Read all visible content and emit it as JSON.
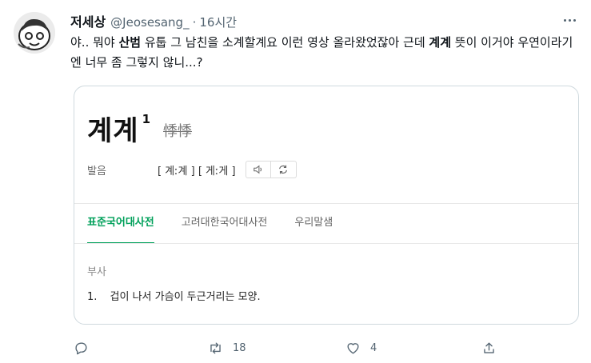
{
  "tweet": {
    "display_name": "저세상",
    "handle": "@Jeosesang_",
    "separator": "·",
    "time": "16시간",
    "text_parts": {
      "p1": "야.. 뭐야 ",
      "b1": "산범",
      "p2": " 유툽 그 남친을 소계할계요 이런 영상 올라왔었잖아 근데 ",
      "b2": "계계",
      "p3": " 뜻이 이거야 우연이라기엔 너무 좀 그렇지 않니...?"
    }
  },
  "card": {
    "word": "계계",
    "superscript": "1",
    "hanja": "悸悸",
    "pron_label": "발음",
    "pron_value": "[ 계ː계 ] [ 게ː게 ]",
    "tabs": [
      "표준국어대사전",
      "고려대한국어대사전",
      "우리말샘"
    ],
    "part_of_speech": "부사",
    "definition_number": "1.",
    "definition": "겁이 나서 가슴이 두근거리는 모양."
  },
  "actions": {
    "reply_count": "",
    "retweet_count": "18",
    "like_count": "4"
  },
  "colors": {
    "accent_green": "#00a05a",
    "secondary_text": "#536471",
    "border": "#cfd9de"
  },
  "icons": [
    "more-icon",
    "speaker-icon",
    "repeat-icon",
    "reply-icon",
    "retweet-icon",
    "like-icon",
    "share-icon"
  ]
}
